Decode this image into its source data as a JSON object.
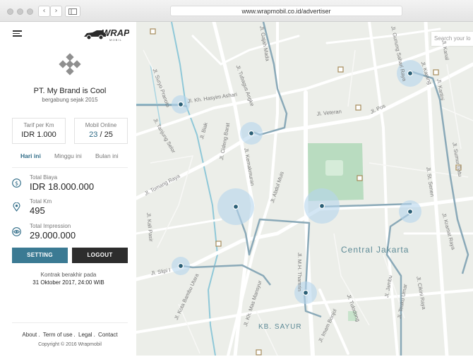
{
  "browser": {
    "url": "www.wrapmobil.co.id/advertiser"
  },
  "sidebar": {
    "company_name": "PT. My Brand is Cool",
    "joined": "bergabung sejak 2015",
    "tarif": {
      "label": "Tarif per Km",
      "value": "IDR 1.000"
    },
    "mobil_online": {
      "label": "Mobil Online",
      "online": "23",
      "separator": " / ",
      "total": "25"
    },
    "tabs": [
      {
        "label": "Hari ini"
      },
      {
        "label": "Minggu ini"
      },
      {
        "label": "Bulan ini"
      }
    ],
    "stats": [
      {
        "label": "Total Biaya",
        "value": "IDR 18.000.000",
        "icon": "dollar-icon"
      },
      {
        "label": "Total Km",
        "value": "495",
        "icon": "location-pin-icon"
      },
      {
        "label": "Total Impression",
        "value": "29.000.000",
        "icon": "eye-icon"
      }
    ],
    "setting_label": "SETTING",
    "logout_label": "LOGOUT",
    "contract_label": "Kontrak berakhir pada",
    "contract_date": "31 Oktober 2017, 24:00 WIB",
    "footer_links": {
      "about": "About",
      "terms": "Term of use",
      "legal": "Legal",
      "contact": "Contact",
      "sep": "."
    },
    "copyright": "Copyright © 2016 Wrapmobil"
  },
  "map": {
    "search_placeholder": "Search your lo",
    "area_main": "Central Jakarta",
    "area_sub": "KB. SAYUR",
    "streets": [
      "Jl. Kh. Hasyim Ashari",
      "Jl. Cideng Barat",
      "Jl. Biak",
      "Jl. Suryo Pranoto",
      "Jl. Veteran",
      "Jl. Pos",
      "Jl. Gunung Sahari Raya",
      "Jl. Tomang Raya",
      "Jl. Abdul Muis",
      "Jl. Kemakmuran",
      "Jl. Slipi I",
      "Jl. Kota Bambu Utara",
      "Jl. Kh. Mas Mansyur",
      "Jl. M.H. Thamrin",
      "Jl. Imam Bonjol",
      "Jl. St. Senen",
      "Jl. Kramat Raya",
      "Jl. Cikini Raya",
      "Jl. Gajah Mada",
      "Jl. Tanjung Selor",
      "Jl. Kali Pasir",
      "Jl. Jambu",
      "Jl. Teuku Umar",
      "Jl. Tulodong",
      "Jl. Kanal",
      "Jl. Tubagus Angke",
      "Jl. Karang",
      "Jl. Kartini",
      "Jl. Sumur Batu"
    ],
    "colors": {
      "route": "#8aa9b8",
      "marker": "#2b5f76",
      "halo": "#b5d6ec",
      "park": "#b9dcc0",
      "water": "#8fc8d8"
    }
  }
}
